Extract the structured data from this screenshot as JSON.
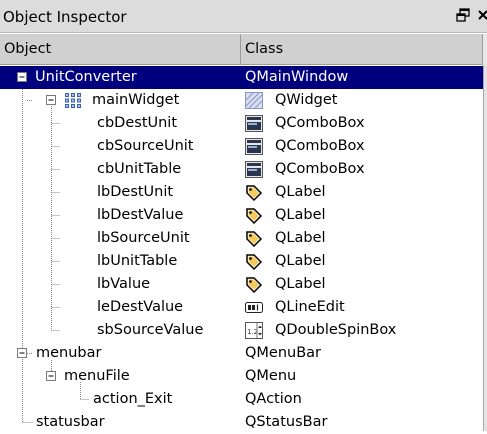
{
  "window": {
    "title": "Object Inspector"
  },
  "header": {
    "object_col": "Object",
    "class_col": "Class"
  },
  "tree": [
    {
      "name": "UnitConverter",
      "cls": "QMainWindow",
      "selected": true
    },
    {
      "name": "mainWidget",
      "cls": "QWidget",
      "icon": "widget-grid-icon",
      "class_icon": "widget-hatched-icon"
    },
    {
      "name": "cbDestUnit",
      "cls": "QComboBox",
      "class_icon": "combobox-icon"
    },
    {
      "name": "cbSourceUnit",
      "cls": "QComboBox",
      "class_icon": "combobox-icon"
    },
    {
      "name": "cbUnitTable",
      "cls": "QComboBox",
      "class_icon": "combobox-icon"
    },
    {
      "name": "lbDestUnit",
      "cls": "QLabel",
      "class_icon": "label-tag-icon"
    },
    {
      "name": "lbDestValue",
      "cls": "QLabel",
      "class_icon": "label-tag-icon"
    },
    {
      "name": "lbSourceUnit",
      "cls": "QLabel",
      "class_icon": "label-tag-icon"
    },
    {
      "name": "lbUnitTable",
      "cls": "QLabel",
      "class_icon": "label-tag-icon"
    },
    {
      "name": "lbValue",
      "cls": "QLabel",
      "class_icon": "label-tag-icon"
    },
    {
      "name": "leDestValue",
      "cls": "QLineEdit",
      "class_icon": "lineedit-icon"
    },
    {
      "name": "sbSourceValue",
      "cls": "QDoubleSpinBox",
      "class_icon": "doublespinbox-icon"
    },
    {
      "name": "menubar",
      "cls": "QMenuBar"
    },
    {
      "name": "menuFile",
      "cls": "QMenu"
    },
    {
      "name": "action_Exit",
      "cls": "QAction"
    },
    {
      "name": "statusbar",
      "cls": "QStatusBar"
    }
  ],
  "colors": {
    "selection": "#00007e",
    "header": "#d0d0d0",
    "titlebar": "#dcdcdc"
  }
}
